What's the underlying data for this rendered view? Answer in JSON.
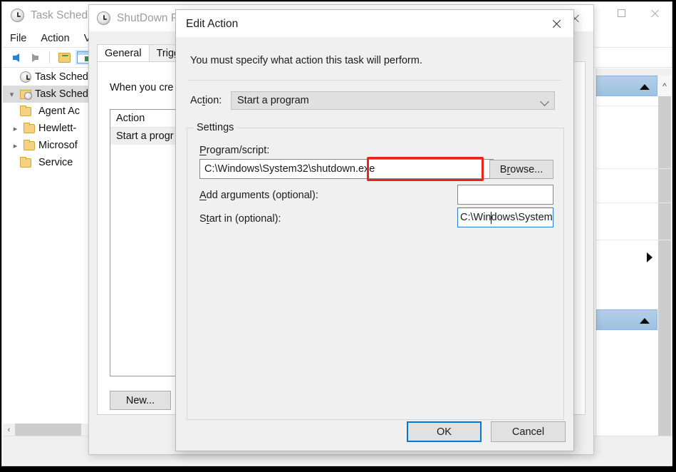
{
  "task_scheduler": {
    "title": "Task Scheduler",
    "menu": [
      {
        "label": "File"
      },
      {
        "label": "Action"
      },
      {
        "label": "Vi"
      }
    ],
    "toolbar": [
      {
        "name": "back-arrow"
      },
      {
        "name": "forward-arrow"
      },
      {
        "name": "show-hide-folder"
      },
      {
        "name": "show-hide-console-tree"
      },
      {
        "name": "properties"
      }
    ],
    "tree": [
      {
        "label": "Task Scheduler",
        "icon": "clock-icon",
        "indent": 0,
        "chevron": "",
        "selected": false
      },
      {
        "label": "Task Schedu",
        "icon": "scheduler-folder-icon",
        "indent": 0,
        "chevron": "v",
        "selected": true
      },
      {
        "label": "Agent Ac",
        "icon": "folder-icon",
        "indent": 1,
        "chevron": "",
        "selected": false
      },
      {
        "label": "Hewlett-",
        "icon": "folder-icon",
        "indent": 1,
        "chevron": ">",
        "selected": false
      },
      {
        "label": "Microsof",
        "icon": "folder-icon",
        "indent": 1,
        "chevron": ">",
        "selected": false
      },
      {
        "label": "Service",
        "icon": "folder-icon",
        "indent": 1,
        "chevron": "",
        "selected": false
      }
    ],
    "window_buttons": {
      "maximize": "maximize-icon",
      "close": "close-icon"
    },
    "hscroll_left": "‹"
  },
  "shutdown_properties": {
    "title": "ShutDown Pr",
    "tabs": [
      {
        "label": "General",
        "active": true
      },
      {
        "label": "Trigge",
        "active": false
      }
    ],
    "description": "When you cre",
    "list": {
      "header": "Action",
      "rows": [
        {
          "value": "Start a progr"
        }
      ]
    },
    "new_button": "New...",
    "close": "close-icon"
  },
  "edit_action": {
    "title": "Edit Action",
    "close": "close-icon",
    "instruction": "You must specify what action this task will perform.",
    "action_label": "Action:",
    "action_value": "Start a program",
    "settings_legend": "Settings",
    "program_label": "Program/script:",
    "program_value": "C:\\Windows\\System32\\shutdown.exe",
    "highlight_text": "C:\\Windows\\System32\\",
    "browse_button": "Browse...",
    "arguments_label": "Add arguments (optional):",
    "arguments_value": "",
    "startin_label": "Start in (optional):",
    "startin_value_before_caret": "C:\\Win",
    "startin_value_after_caret": "dows\\System",
    "ok_button": "OK",
    "cancel_button": "Cancel",
    "highlight_color": "#e8241b",
    "focus_color": "#0078d7"
  }
}
